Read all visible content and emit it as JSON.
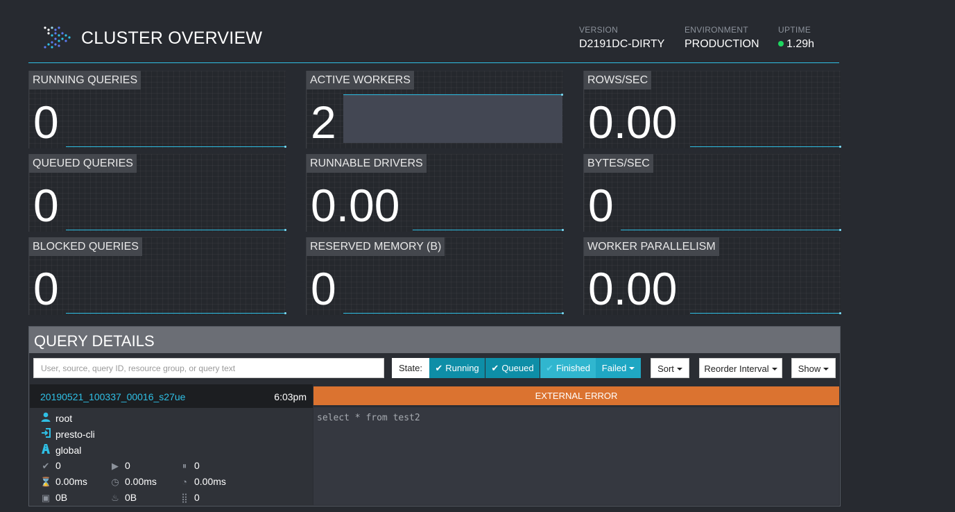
{
  "header": {
    "title": "CLUSTER OVERVIEW",
    "version": {
      "label": "VERSION",
      "value": "D2191DC-DIRTY"
    },
    "environment": {
      "label": "ENVIRONMENT",
      "value": "PRODUCTION"
    },
    "uptime": {
      "label": "UPTIME",
      "value": "1.29h",
      "status_color": "#1ed760"
    }
  },
  "tiles": [
    {
      "label": "RUNNING QUERIES",
      "value": "0"
    },
    {
      "label": "ACTIVE WORKERS",
      "value": "2"
    },
    {
      "label": "ROWS/SEC",
      "value": "0.00"
    },
    {
      "label": "QUEUED QUERIES",
      "value": "0"
    },
    {
      "label": "RUNNABLE DRIVERS",
      "value": "0.00"
    },
    {
      "label": "BYTES/SEC",
      "value": "0"
    },
    {
      "label": "BLOCKED QUERIES",
      "value": "0"
    },
    {
      "label": "RESERVED MEMORY (B)",
      "value": "0"
    },
    {
      "label": "WORKER PARALLELISM",
      "value": "0.00"
    }
  ],
  "query_details": {
    "title": "QUERY DETAILS",
    "search_placeholder": "User, source, query ID, resource group, or query text",
    "state_label": "State:",
    "filters": {
      "running": "Running",
      "queued": "Queued",
      "finished": "Finished",
      "failed": "Failed"
    },
    "sort_label": "Sort",
    "reorder_label": "Reorder Interval",
    "show_label": "Show"
  },
  "query": {
    "id": "20190521_100337_00016_s27ue",
    "time": "6:03pm",
    "user": "root",
    "source": "presto-cli",
    "resource_group": "global",
    "stats": {
      "completed_splits": "0",
      "running_splits": "0",
      "queued_splits": "0",
      "elapsed": "0.00ms",
      "cpu": "0.00ms",
      "wall": "0.00ms",
      "memory": "0B",
      "peak_memory": "0B",
      "drivers": "0"
    },
    "state": "EXTERNAL ERROR",
    "state_color": "#db7330",
    "text": "select * from test2"
  },
  "colors": {
    "accent": "#2fc0e6",
    "filter_active": "#0e8ea7",
    "filter_finished": "#30b6cf",
    "filter_failed": "#1fa7c3"
  }
}
